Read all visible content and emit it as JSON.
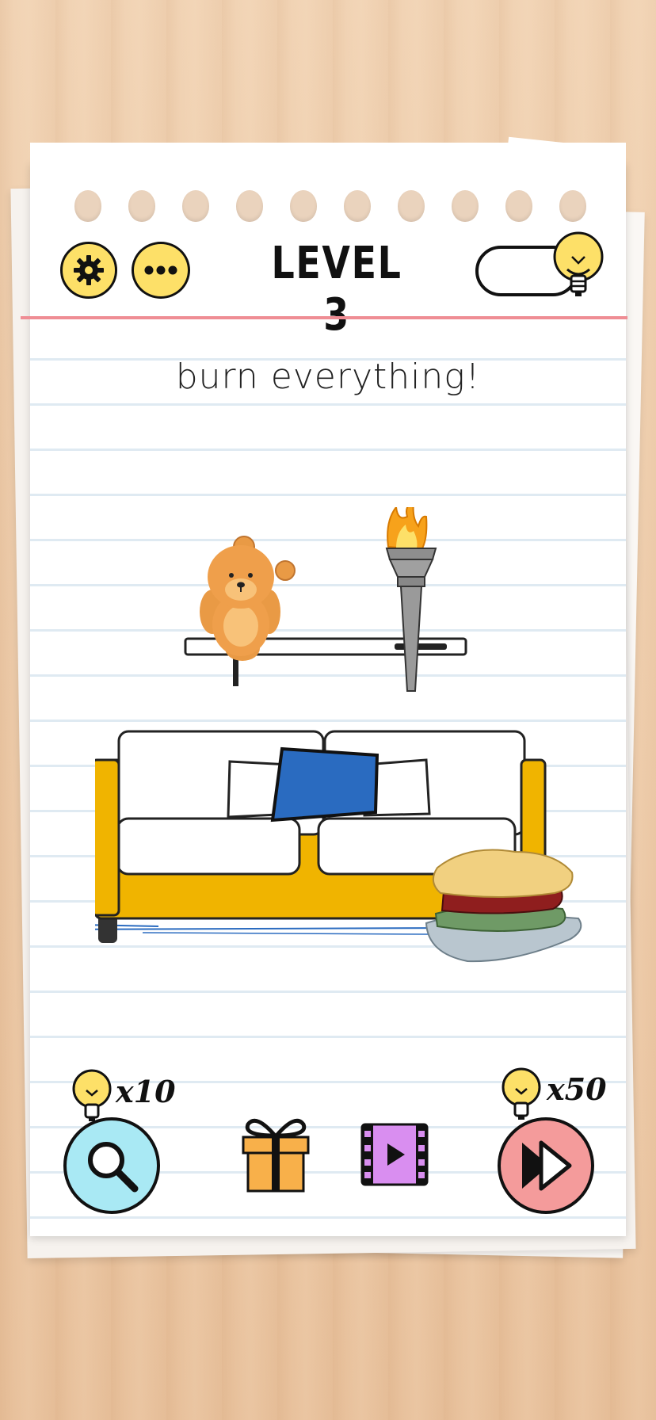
{
  "header": {
    "level_label": "LEVEL 3",
    "settings_icon": "gear-icon",
    "menu_icon": "more-dots-icon",
    "hint_icon": "lightbulb-icon"
  },
  "puzzle": {
    "instruction": "burn everything!"
  },
  "scene": {
    "objects": [
      "teddy-bear",
      "torch",
      "wall-shelf",
      "sofa",
      "blue-pillow",
      "pile-of-clothes"
    ]
  },
  "toolbar": {
    "search": {
      "cost": "x10",
      "icon": "magnifier-icon"
    },
    "gift": {
      "icon": "gift-icon"
    },
    "video": {
      "icon": "video-play-icon"
    },
    "skip": {
      "cost": "x50",
      "icon": "skip-forward-icon"
    }
  },
  "colors": {
    "yellow": "#fde068",
    "search_bg": "#a9e9f4",
    "skip_bg": "#f49b9b",
    "gift": "#f8b04a",
    "video": "#d98ef0",
    "sofa": "#f0b400",
    "pillow": "#2a6bc0"
  }
}
